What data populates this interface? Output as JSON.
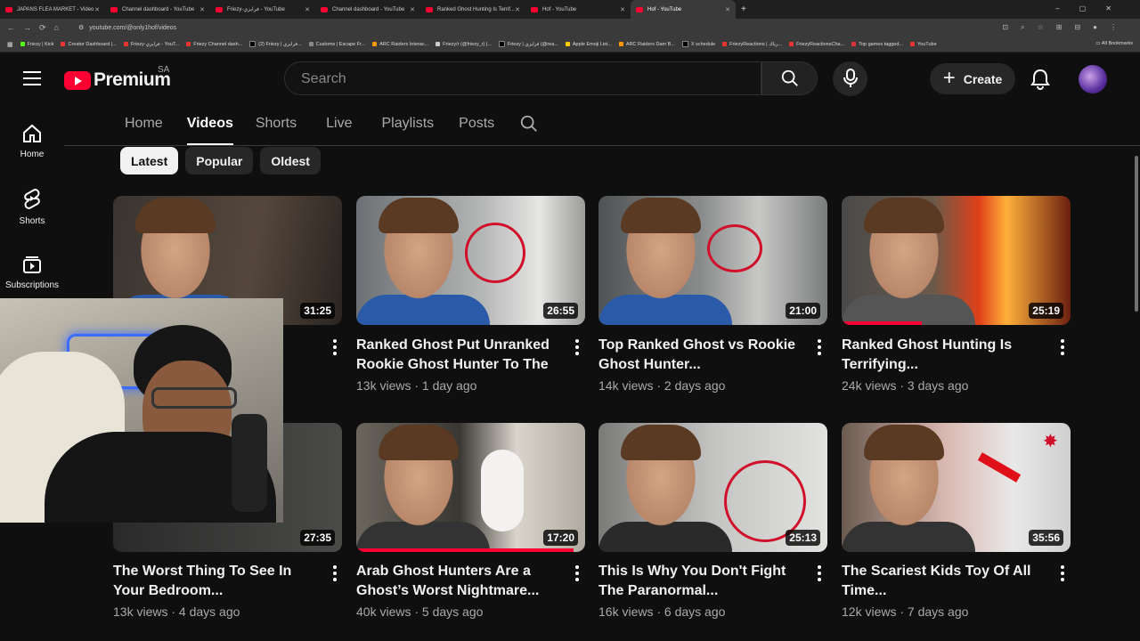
{
  "browser": {
    "tabs": [
      {
        "title": "JAPANS FLEA MARKET - Video"
      },
      {
        "title": "Channel dashboard - YouTube"
      },
      {
        "title": "Friezy-فرايزي - YouTube"
      },
      {
        "title": "Channel dashboard - YouTube"
      },
      {
        "title": "Ranked Ghost Hunting Is Terrif..."
      },
      {
        "title": "Hof - YouTube"
      },
      {
        "title": "Hof - YouTube"
      }
    ],
    "url": "youtube.com/@only1hof/videos",
    "bookmarks": [
      "Friezy | Kick",
      "Creator Dashboard |...",
      "Friezy-فرايزي - YouT...",
      "Friezy Channel dash...",
      "(2) Friezy | فرايزي...",
      "Customs | Escape Fr...",
      "ARC Raiders Interac...",
      "Friezy/r (@friezy_r) |...",
      "Friezy | فرايزي (@rea...",
      "Apple Emoji List...",
      "ARC Raiders Dam B...",
      "X schedule",
      "FriezyReactions | رياك...",
      "FriezyReactionsCha...",
      "Top games tagged...",
      "YouTube"
    ],
    "all_bookmarks": "All Bookmarks"
  },
  "header": {
    "logo_text": "Premium",
    "region": "SA",
    "search_placeholder": "Search",
    "create_label": "Create"
  },
  "guide": [
    {
      "label": "Home",
      "icon": "home-icon"
    },
    {
      "label": "Shorts",
      "icon": "shorts-icon"
    },
    {
      "label": "Subscriptions",
      "icon": "subscriptions-icon"
    }
  ],
  "channel_tabs": [
    "Home",
    "Videos",
    "Shorts",
    "Live",
    "Playlists",
    "Posts"
  ],
  "active_tab": "Videos",
  "chips": [
    "Latest",
    "Popular",
    "Oldest"
  ],
  "active_chip": "Latest",
  "videos": [
    {
      "title": "",
      "views": "",
      "age": "",
      "duration": "31:25"
    },
    {
      "title": "Ranked Ghost Put Unranked Rookie Ghost Hunter To The ...",
      "views": "13k views",
      "age": "1 day ago",
      "duration": "26:55"
    },
    {
      "title": "Top Ranked Ghost vs Rookie Ghost Hunter...",
      "views": "14k views",
      "age": "2 days ago",
      "duration": "21:00"
    },
    {
      "title": "Ranked Ghost Hunting Is Terrifying...",
      "views": "24k views",
      "age": "3 days ago",
      "duration": "25:19",
      "watched": 0.35
    },
    {
      "title": "The Worst Thing To See In Your Bedroom...",
      "views": "13k views",
      "age": "4 days ago",
      "duration": "27:35"
    },
    {
      "title": "Arab Ghost Hunters Are a Ghost’s Worst Nightmare...",
      "views": "40k views",
      "age": "5 days ago",
      "duration": "17:20",
      "watched": 0.95
    },
    {
      "title": "This Is Why You Don't Fight The Paranormal...",
      "views": "16k views",
      "age": "6 days ago",
      "duration": "25:13"
    },
    {
      "title": "The Scariest Kids Toy Of All Time...",
      "views": "12k views",
      "age": "7 days ago",
      "duration": "35:56"
    }
  ],
  "colors": {
    "accent": "#ff0033",
    "background": "#0f0f0f",
    "chip": "#272727",
    "meta_text": "#aaaaaa"
  }
}
